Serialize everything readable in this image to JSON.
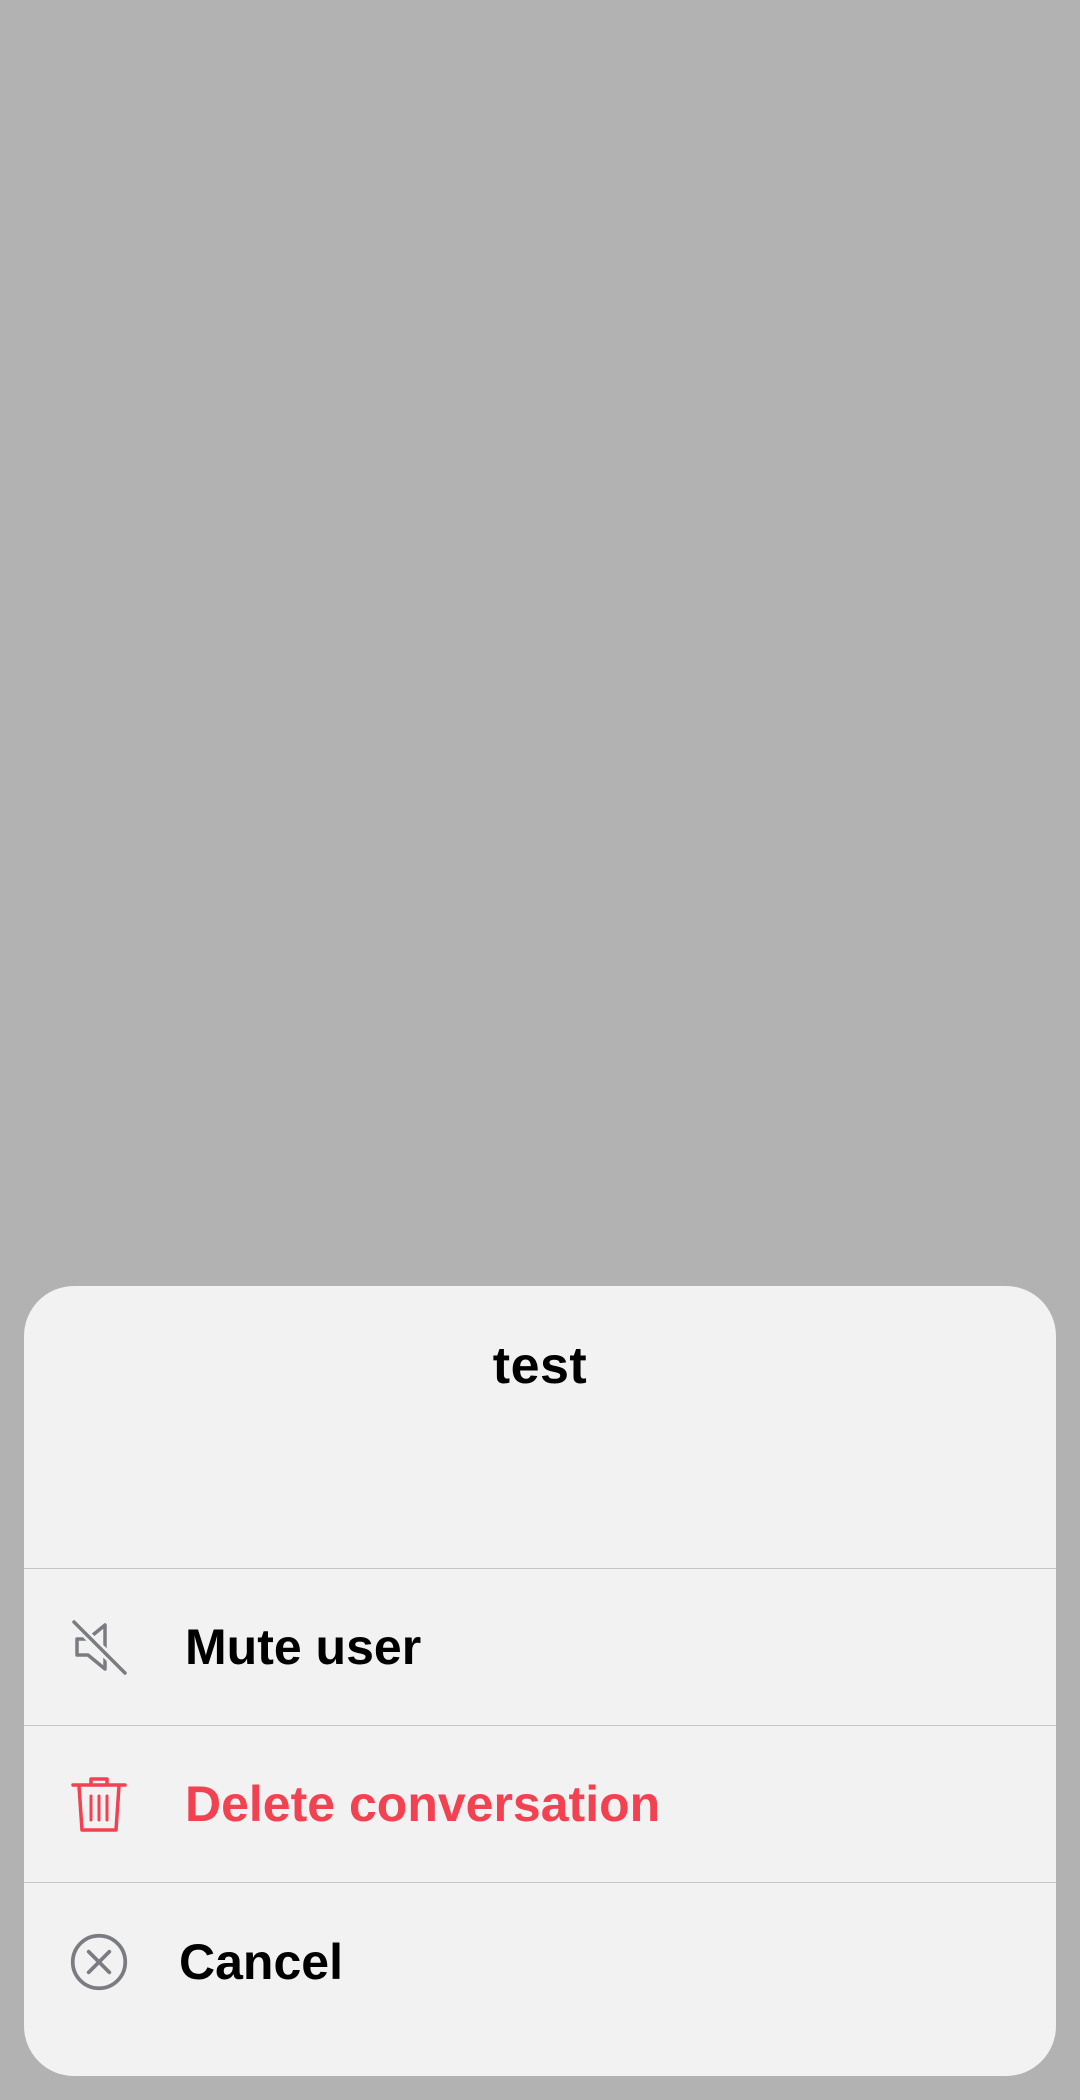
{
  "sheet": {
    "title": "test",
    "actions": [
      {
        "label": "Mute user",
        "icon": "mute-icon",
        "color": "#000000"
      },
      {
        "label": "Delete conversation",
        "icon": "trash-icon",
        "color": "#f24150"
      },
      {
        "label": "Cancel",
        "icon": "cancel-circle-icon",
        "color": "#000000"
      }
    ]
  },
  "colors": {
    "backdrop": "#b2b2b2",
    "sheet_background": "#f2f2f2",
    "destructive": "#f24150",
    "icon_gray": "#7a7c82"
  }
}
